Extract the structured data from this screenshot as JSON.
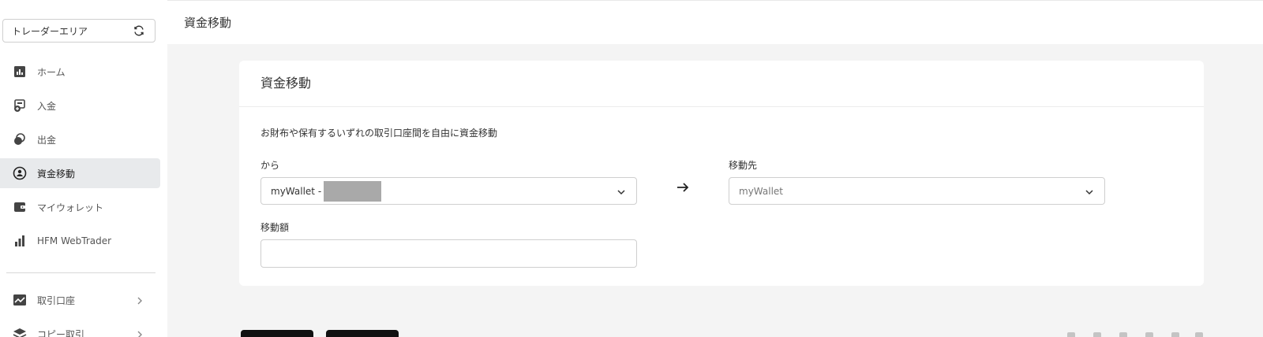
{
  "sidebar": {
    "area_selector": {
      "label": "トレーダーエリア",
      "icon": "refresh-icon"
    },
    "items": [
      {
        "label": "ホーム",
        "icon": "bar-chart-icon",
        "active": false
      },
      {
        "label": "入金",
        "icon": "deposit-icon",
        "active": false
      },
      {
        "label": "出金",
        "icon": "withdraw-icon",
        "active": false
      },
      {
        "label": "資金移動",
        "icon": "transfer-icon",
        "active": true
      },
      {
        "label": "マイウォレット",
        "icon": "wallet-icon",
        "active": false
      },
      {
        "label": "HFM WebTrader",
        "icon": "signal-bars-icon",
        "active": false
      }
    ],
    "sections": [
      {
        "label": "取引口座",
        "icon": "trend-chart-icon"
      },
      {
        "label": "コピー取引",
        "icon": "layers-icon"
      }
    ]
  },
  "header": {
    "title": "資金移動"
  },
  "card": {
    "title": "資金移動",
    "description": "お財布や保有するいずれの取引口座間を自由に資金移動",
    "from": {
      "label": "から",
      "value": "myWallet - "
    },
    "to": {
      "label": "移動先",
      "placeholder": "myWallet"
    },
    "amount": {
      "label": "移動額",
      "value": ""
    }
  },
  "colors": {
    "active_bg": "#e8eaec",
    "page_bg": "#f4f4f4",
    "border": "#cfcfcf"
  }
}
